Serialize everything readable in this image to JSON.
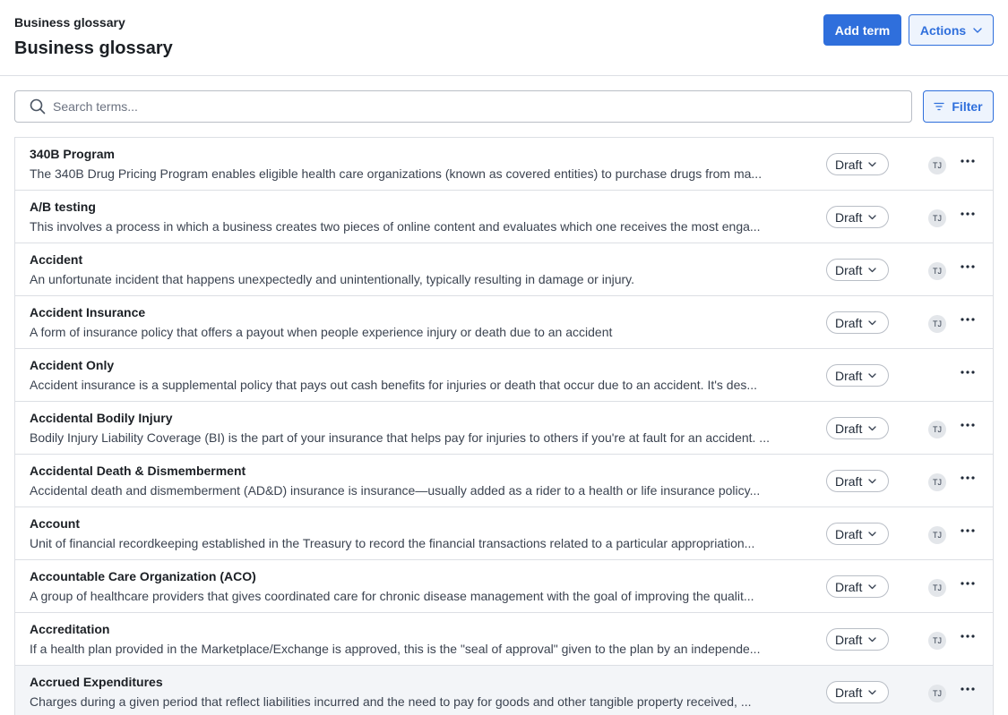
{
  "header": {
    "breadcrumb": "Business glossary",
    "title": "Business glossary",
    "add_label": "Add term",
    "actions_label": "Actions"
  },
  "search": {
    "placeholder": "Search terms...",
    "value": ""
  },
  "filter": {
    "label": "Filter"
  },
  "colors": {
    "accent": "#2f6fdc",
    "accent_soft": "#eef4fd",
    "row_hover": "#f3f5f8",
    "border": "#dcdfe4"
  },
  "icons": {
    "search": "search-icon",
    "filter": "filter-icon",
    "chevron": "chevron-down-icon",
    "more": "more-horizontal-icon"
  },
  "terms": [
    {
      "name": "340B Program",
      "description": "The 340B Drug Pricing Program enables eligible health care organizations (known as covered entities) to purchase drugs from ma...",
      "status": "Draft",
      "owner": "TJ"
    },
    {
      "name": "A/B testing",
      "description": "This involves a process in which a business creates two pieces of online content and evaluates which one receives the most enga...",
      "status": "Draft",
      "owner": "TJ"
    },
    {
      "name": "Accident",
      "description": "An unfortunate incident that happens unexpectedly and unintentionally, typically resulting in damage or injury.",
      "status": "Draft",
      "owner": "TJ"
    },
    {
      "name": "Accident Insurance",
      "description": "A form of insurance policy that offers a payout when people experience injury or death due to an accident",
      "status": "Draft",
      "owner": "TJ"
    },
    {
      "name": "Accident Only",
      "description": "Accident insurance is a supplemental policy that pays out cash benefits for injuries or death that occur due to an accident. It's des...",
      "status": "Draft",
      "owner": ""
    },
    {
      "name": "Accidental Bodily Injury",
      "description": "Bodily Injury Liability Coverage (BI) is the part of your insurance that helps pay for injuries to others if you're at fault for an accident. ...",
      "status": "Draft",
      "owner": "TJ"
    },
    {
      "name": "Accidental Death & Dismemberment",
      "description": "Accidental death and dismemberment (AD&D) insurance is insurance—usually added as a rider to a health or life insurance policy...",
      "status": "Draft",
      "owner": "TJ"
    },
    {
      "name": "Account",
      "description": "Unit of financial recordkeeping established in the Treasury to record the financial transactions related to a particular appropriation...",
      "status": "Draft",
      "owner": "TJ"
    },
    {
      "name": "Accountable Care Organization (ACO)",
      "description": "A group of healthcare providers that gives coordinated care for chronic disease management with the goal of improving the qualit...",
      "status": "Draft",
      "owner": "TJ"
    },
    {
      "name": "Accreditation",
      "description": "If a health plan provided in the Marketplace/Exchange is approved, this is the \"seal of approval\" given to the plan by an independe...",
      "status": "Draft",
      "owner": "TJ"
    },
    {
      "name": "Accrued Expenditures",
      "description": "Charges during a given period that reflect liabilities incurred and the need to pay for goods and other tangible property received, ...",
      "status": "Draft",
      "owner": "TJ"
    }
  ]
}
